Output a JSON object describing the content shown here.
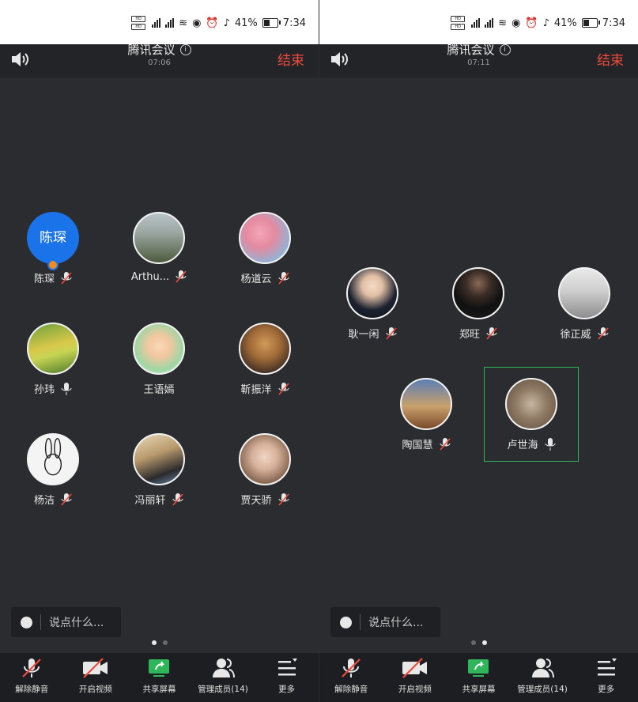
{
  "status_bar": {
    "battery": "41%",
    "time": "7:34",
    "battery_level": 0.41
  },
  "meeting": {
    "title": "腾讯会议",
    "end_label": "结束"
  },
  "screens": [
    {
      "timer": "07:06",
      "participants": [
        {
          "name": "陈琛",
          "avatar_text": "陈琛",
          "muted": true,
          "host": true
        },
        {
          "name": "Arthu...",
          "muted": true
        },
        {
          "name": "杨道云",
          "muted": true
        },
        {
          "name": "孙玮",
          "muted": false
        },
        {
          "name": "王语嫣",
          "muted": false
        },
        {
          "name": "靳振洋",
          "muted": true
        },
        {
          "name": "杨洁",
          "muted": true
        },
        {
          "name": "冯丽轩",
          "muted": true
        },
        {
          "name": "贾天骄",
          "muted": true
        }
      ],
      "chat_placeholder": "说点什么...",
      "page_dots": [
        true,
        false
      ]
    },
    {
      "timer": "07:11",
      "participants": [
        {
          "name": "耿一闲",
          "muted": true
        },
        {
          "name": "郑旺",
          "muted": true
        },
        {
          "name": "徐正威",
          "muted": true
        },
        {
          "name": "陶国慧",
          "muted": true
        },
        {
          "name": "卢世海",
          "muted": false,
          "speaking": true
        }
      ],
      "chat_placeholder": "说点什么...",
      "page_dots": [
        false,
        true
      ]
    }
  ],
  "toolbar": {
    "unmute": "解除静音",
    "video": "开启视频",
    "share": "共享屏幕",
    "members": "管理成员(14)",
    "more": "更多"
  },
  "colors": {
    "end": "#f04a3c",
    "share": "#2fb55a",
    "host_avatar": "#1a73e8",
    "speaking_border": "#2fb55a"
  }
}
